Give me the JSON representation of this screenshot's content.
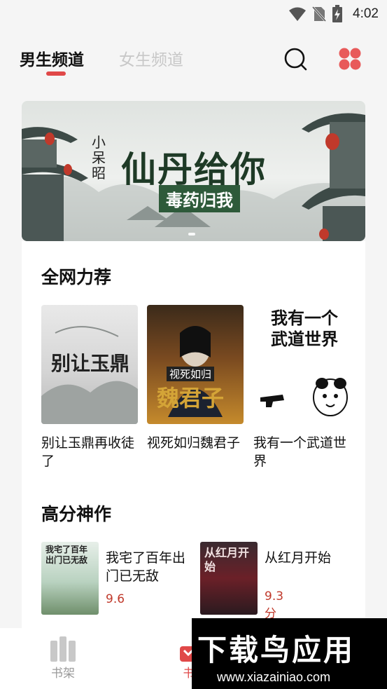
{
  "status_bar": {
    "time": "4:02"
  },
  "header": {
    "tabs": [
      {
        "label": "男生频道",
        "active": true
      },
      {
        "label": "女生频道",
        "active": false
      }
    ]
  },
  "banner": {
    "author": "小呆昭",
    "title": "仙丹给你",
    "subtitle": "毒药归我"
  },
  "recommend": {
    "title": "全网力荐",
    "books": [
      {
        "title": "别让玉鼎再收徒了",
        "cover_text": "别让玉鼎"
      },
      {
        "title": "视死如归魏君子",
        "cover_text": "魏君子",
        "cover_sub": "视死如归"
      },
      {
        "title": "我有一个武道世界",
        "cover_text": "我有一个\n武道世界"
      }
    ]
  },
  "top_rated": {
    "title": "高分神作",
    "books": [
      {
        "title": "我宅了百年出门已无敌",
        "score": "9.6",
        "cover_text": "我宅了百年出门已无敌"
      },
      {
        "title": "从红月开始",
        "score": "9.3分",
        "cover_text": "从红月开始"
      }
    ]
  },
  "bottom_nav": {
    "items": [
      {
        "label": "书架",
        "icon": "bookshelf-icon"
      },
      {
        "label": "书",
        "icon": "bookstore-icon"
      }
    ]
  },
  "watermark": {
    "title": "下载鸟应用",
    "url": "www.xiazainiao.com"
  },
  "colors": {
    "accent": "#e04848",
    "score": "#c0392b",
    "inactive": "#c8c8c8"
  }
}
